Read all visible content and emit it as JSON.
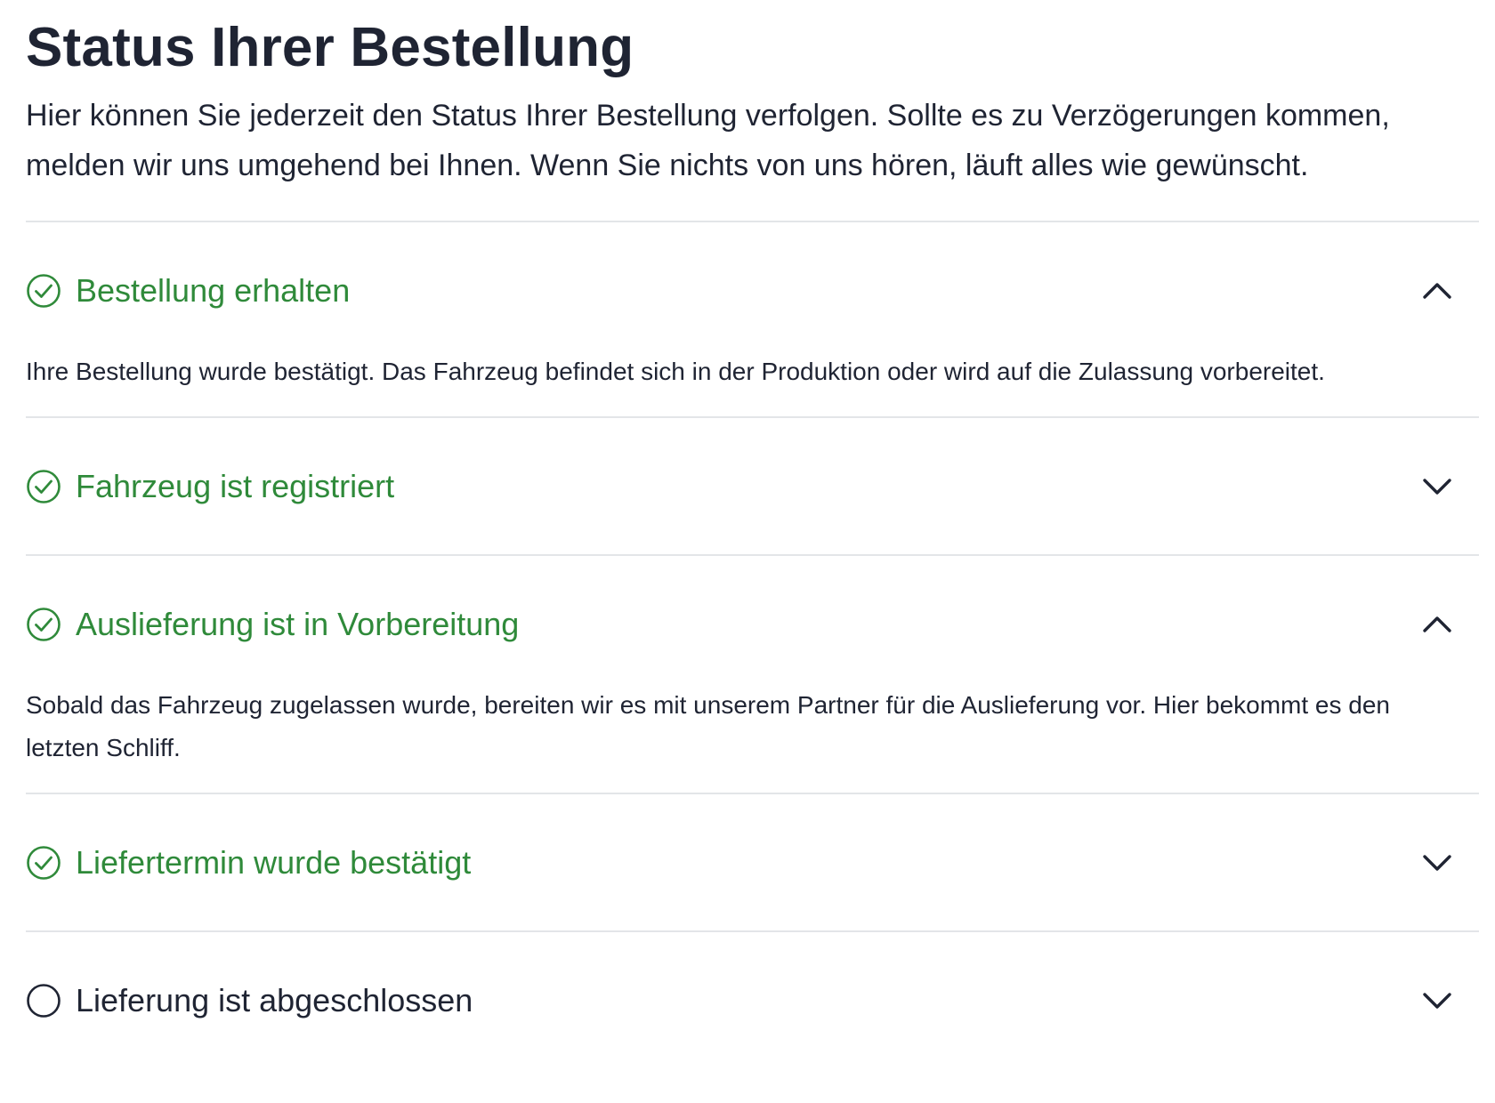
{
  "page": {
    "title": "Status Ihrer Bestellung",
    "intro": "Hier können Sie jederzeit den Status Ihrer Bestellung verfolgen. Sollte es zu Verzögerungen kommen, melden wir uns umgehend bei Ihnen. Wenn Sie nichts von uns hören, läuft alles wie gewünscht."
  },
  "colors": {
    "completed": "#2f8a3a",
    "pending": "#1f2433",
    "divider": "#e3e5e8"
  },
  "steps": [
    {
      "title": "Bestellung erhalten",
      "status": "completed",
      "expanded": true,
      "icon": "check-circle-icon",
      "toggle_icon": "chevron-up-icon",
      "body": "Ihre Bestellung wurde bestätigt. Das Fahrzeug befindet sich in der Produktion oder wird auf die Zulassung vorbereitet."
    },
    {
      "title": "Fahrzeug ist registriert",
      "status": "completed",
      "expanded": false,
      "icon": "check-circle-icon",
      "toggle_icon": "chevron-down-icon",
      "body": ""
    },
    {
      "title": "Auslieferung ist in Vorbereitung",
      "status": "completed",
      "expanded": true,
      "icon": "check-circle-icon",
      "toggle_icon": "chevron-up-icon",
      "body": "Sobald das Fahrzeug zugelassen wurde, bereiten wir es mit unserem Partner für die Auslieferung vor. Hier bekommt es den letzten Schliff."
    },
    {
      "title": "Liefertermin wurde bestätigt",
      "status": "completed",
      "expanded": false,
      "icon": "check-circle-icon",
      "toggle_icon": "chevron-down-icon",
      "body": ""
    },
    {
      "title": "Lieferung ist abgeschlossen",
      "status": "pending",
      "expanded": false,
      "icon": "empty-circle-icon",
      "toggle_icon": "chevron-down-icon",
      "body": ""
    }
  ]
}
